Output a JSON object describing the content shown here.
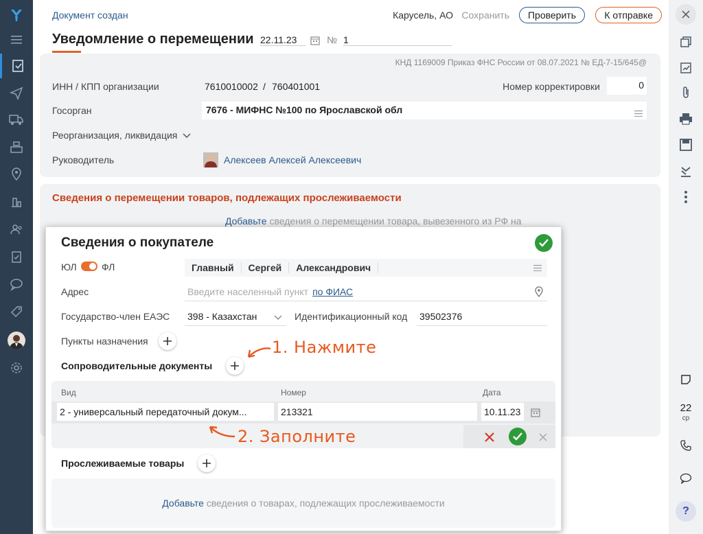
{
  "header": {
    "status": "Документ создан",
    "company": "Карусель, АО",
    "save_label": "Сохранить",
    "check_label": "Проверить",
    "send_label": "К отправке"
  },
  "document": {
    "title": "Уведомление о перемещении",
    "date": "22.11.23",
    "number_label": "№",
    "number": "1",
    "knd": "КНД 1169009 Приказ ФНС России от 08.07.2021 № ЕД-7-15/645@"
  },
  "org": {
    "inn_label": "ИНН / КПП организации",
    "inn": "7610010002",
    "sep": "/",
    "kpp": "760401001",
    "correction_label": "Номер корректировки",
    "correction": "0",
    "gosorgan_label": "Госорган",
    "gosorgan": "7676 - МИФНС №100 по Ярославской обл",
    "reorg_label": "Реорганизация, ликвидация",
    "head_label": "Руководитель",
    "head": "Алексеев Алексей Алексеевич"
  },
  "section": {
    "title": "Сведения о перемещении товаров, подлежащих прослеживаемости",
    "add_link": "Добавьте",
    "add_hint": " сведения о перемещении товара, вывезенного из РФ на"
  },
  "modal": {
    "title": "Сведения о покупателе",
    "ul": "ЮЛ",
    "fl": "ФЛ",
    "last_name": "Главный",
    "first_name": "Сергей",
    "middle_name": "Александрович",
    "address_label": "Адрес",
    "address_placeholder": "Введите населенный пункт",
    "address_fias": "по ФИАС",
    "country_label": "Государство-член ЕАЭС",
    "country": "398 - Казахстан",
    "idcode_label": "Идентификационный код",
    "idcode": "39502376",
    "points_label": "Пункты назначения",
    "docs_label": "Сопроводительные документы",
    "col_type": "Вид",
    "col_number": "Номер",
    "col_date": "Дата",
    "doc_type": "2 - универсальный передаточный докум...",
    "doc_number": "213321",
    "doc_date": "10.11.23",
    "goods_label": "Прослеживаемые товары",
    "goods_link": "Добавьте",
    "goods_hint": " сведения о товарах, подлежащих прослеживаемости"
  },
  "annotations": {
    "step1": "1. Нажмите",
    "step2": "2. Заполните"
  },
  "right_sidebar": {
    "day": "22",
    "weekday": "ср",
    "help": "?"
  },
  "colors": {
    "accent": "#e0602a",
    "link": "#2b5b8d",
    "sidebar": "#2d3e50",
    "ok": "#2e9b3a",
    "section_title": "#c8421d"
  }
}
